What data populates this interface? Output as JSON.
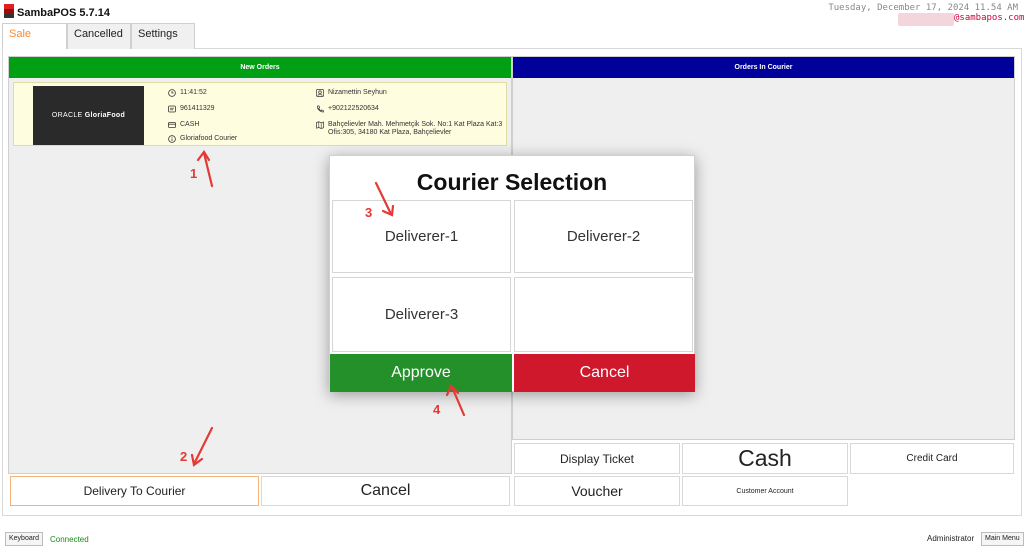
{
  "app": {
    "title": "SambaPOS 5.7.14",
    "datetime": "Tuesday, December 17, 2024 11.54 AM",
    "user_email": "@sambapos.com"
  },
  "tabs": [
    {
      "label": "Sale",
      "active": true
    },
    {
      "label": "Cancelled",
      "active": false
    },
    {
      "label": "Settings",
      "active": false
    }
  ],
  "left_panel": {
    "header": "New Orders",
    "header_color": "#009f14",
    "order": {
      "logo_brand": "ORACLE",
      "logo_product": "GloriaFood",
      "time": "11:41:52",
      "order_no": "961411329",
      "payment": "CASH",
      "courier": "Gloriafood Courier",
      "customer_name": "Nizamettin Seyhun",
      "phone": "+902122520634",
      "address": "Bahçelievler Mah. Mehmetçik Sok. No:1 Kat Plaza Kat:3 Ofis:305, 34180 Kat Plaza, Bahçelievler"
    }
  },
  "right_panel": {
    "header": "Orders In Courier",
    "header_color": "#00009b"
  },
  "dialog": {
    "title": "Courier Selection",
    "couriers": [
      "Deliverer-1",
      "Deliverer-2",
      "Deliverer-3"
    ],
    "approve_label": "Approve",
    "cancel_label": "Cancel",
    "approve_color": "#23902a",
    "cancel_color": "#d0182d"
  },
  "bottom_left": {
    "delivery_to_courier": "Delivery To Courier",
    "cancel": "Cancel"
  },
  "bottom_right": {
    "display_ticket": "Display Ticket",
    "cash": "Cash",
    "credit_card": "Credit Card",
    "voucher": "Voucher",
    "customer_account": "Customer Account"
  },
  "annotations": [
    "1",
    "2",
    "3",
    "4"
  ],
  "status_bar": {
    "keyboard": "Keyboard",
    "connected": "Connected",
    "user": "Administrator",
    "main_menu": "Main Menu"
  }
}
